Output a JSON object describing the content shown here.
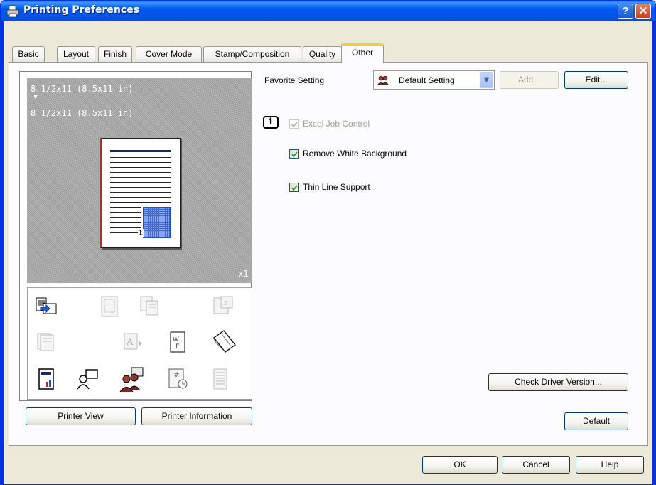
{
  "window": {
    "title": "Printing Preferences",
    "help_button": "?",
    "close_button": "✕"
  },
  "tabs": [
    {
      "label": "Basic"
    },
    {
      "label": "Layout"
    },
    {
      "label": "Finish"
    },
    {
      "label": "Cover Mode"
    },
    {
      "label": "Stamp/Composition"
    },
    {
      "label": "Quality"
    },
    {
      "label": "Other",
      "active": true
    }
  ],
  "preview": {
    "original_size": "8 1/2x11 (8.5x11 in)",
    "arrow": "▼",
    "output_size": "8 1/2x11 (8.5x11 in)",
    "copies": "x1",
    "page_number": "1"
  },
  "preview_buttons": {
    "printer_view": "Printer View",
    "printer_information": "Printer Information"
  },
  "favorite": {
    "label": "Favorite Setting",
    "selected": "Default Setting",
    "add_label": "Add...",
    "edit_label": "Edit..."
  },
  "options": {
    "excel_job_control": {
      "label": "Excel Job Control",
      "checked": true,
      "enabled": false
    },
    "remove_white_background": {
      "label": "Remove White Background",
      "checked": true,
      "enabled": true
    },
    "thin_line_support": {
      "label": "Thin Line Support",
      "checked": true,
      "enabled": true
    }
  },
  "panel_buttons": {
    "check_driver_version": "Check Driver Version...",
    "default": "Default"
  },
  "dialog_buttons": {
    "ok": "OK",
    "cancel": "Cancel",
    "help": "Help"
  },
  "colors": {
    "titlebar": "#0058ee",
    "active_tab_accent": "#ffc83c",
    "dialog_bg": "#ece9d8",
    "checkbox_mark": "#21a121"
  }
}
